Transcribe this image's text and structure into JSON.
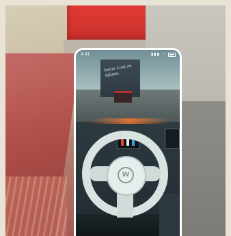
{
  "phone": {
    "status_time": "9:41",
    "status_icons": [
      "signal-icon",
      "wifi-icon",
      "battery-icon"
    ]
  },
  "screen_content": {
    "truck_text": "keine Lust zu fahren."
  },
  "colors": {
    "shelter_red": "#e03a34",
    "ambient_light": "#ff7a2a",
    "phone_frame": "#ffffff"
  }
}
